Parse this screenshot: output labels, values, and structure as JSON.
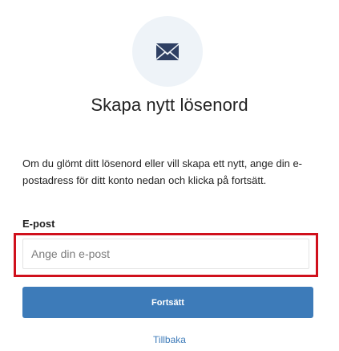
{
  "header": {
    "icon": "envelope-icon",
    "title": "Skapa nytt lösenord"
  },
  "description": "Om du glömt ditt lösenord eller vill skapa ett nytt, ange din e-postadress för ditt konto nedan och klicka på fortsätt.",
  "form": {
    "email_label": "E-post",
    "email_placeholder": "Ange din e-post",
    "email_value": "",
    "submit_label": "Fortsätt"
  },
  "footer": {
    "back_link": "Tillbaka"
  },
  "colors": {
    "accent": "#3d7bb9",
    "icon_background": "#eef3f8",
    "icon_color": "#2e3f63",
    "highlight_border": "#d0101c"
  }
}
